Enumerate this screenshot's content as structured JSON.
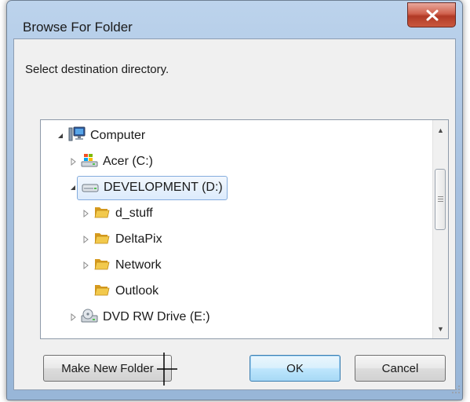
{
  "window": {
    "title": "Browse For Folder",
    "close_label": "X"
  },
  "prompt": "Select destination directory.",
  "tree": {
    "items": [
      {
        "label": "Computer",
        "icon": "computer-icon",
        "expander": "expanded"
      },
      {
        "label": "Acer (C:)",
        "icon": "windows-drive-icon",
        "expander": "collapsed"
      },
      {
        "label": "DEVELOPMENT (D:)",
        "icon": "hard-drive-icon",
        "expander": "expanded",
        "selected": true
      },
      {
        "label": "d_stuff",
        "icon": "folder-icon",
        "expander": "collapsed"
      },
      {
        "label": "DeltaPix",
        "icon": "folder-icon",
        "expander": "collapsed"
      },
      {
        "label": "Network",
        "icon": "folder-icon",
        "expander": "collapsed"
      },
      {
        "label": "Outlook",
        "icon": "folder-icon",
        "expander": "none"
      },
      {
        "label": "DVD RW Drive (E:)",
        "icon": "dvd-drive-icon",
        "expander": "collapsed"
      }
    ]
  },
  "buttons": {
    "make_new_folder": "Make New Folder",
    "ok": "OK",
    "cancel": "Cancel"
  },
  "colors": {
    "title_bar": "#a7c1e0",
    "close_button": "#c9583f",
    "selection_border": "#84acdd",
    "folder": "#e8b63c"
  }
}
